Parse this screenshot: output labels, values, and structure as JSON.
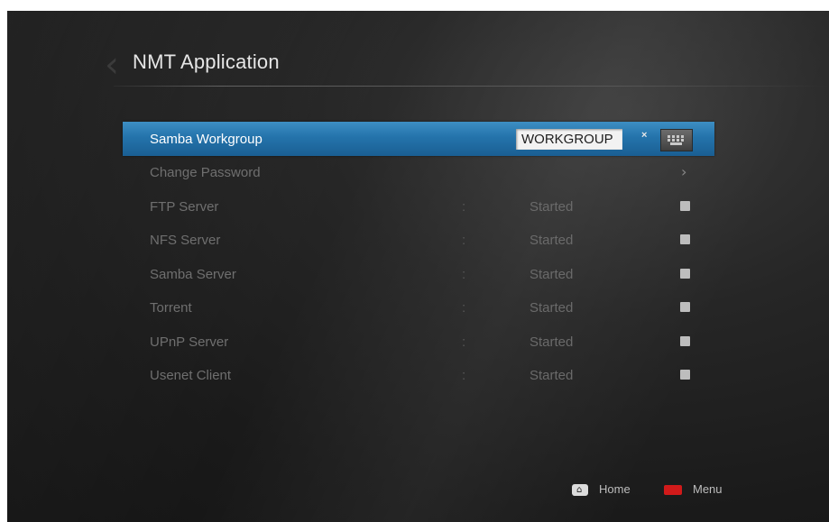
{
  "app": {
    "title": "NMT Application"
  },
  "settings": {
    "selected": {
      "label": "Samba Workgroup",
      "input_value": "WORKGROUP",
      "clear_label": "×"
    },
    "change_password": {
      "label": "Change Password",
      "chevron": "›"
    },
    "services": [
      {
        "label": "FTP Server",
        "separator": ":",
        "status": "Started",
        "checked": true
      },
      {
        "label": "NFS Server",
        "separator": ":",
        "status": "Started",
        "checked": true
      },
      {
        "label": "Samba Server",
        "separator": ":",
        "status": "Started",
        "checked": true
      },
      {
        "label": "Torrent",
        "separator": ":",
        "status": "Started",
        "checked": true
      },
      {
        "label": "UPnP Server",
        "separator": ":",
        "status": "Started",
        "checked": true
      },
      {
        "label": "Usenet Client",
        "separator": ":",
        "status": "Started",
        "checked": true
      }
    ]
  },
  "footer": {
    "home_label": "Home",
    "menu_label": "Menu"
  },
  "colors": {
    "selection": "#2473ab",
    "menu_key": "#d11a1a",
    "background": "#1a1a1a"
  },
  "icons": [
    "back-arrow-icon",
    "chevron-right-icon",
    "clear-icon",
    "keyboard-icon",
    "home-icon",
    "menu-key-icon"
  ]
}
